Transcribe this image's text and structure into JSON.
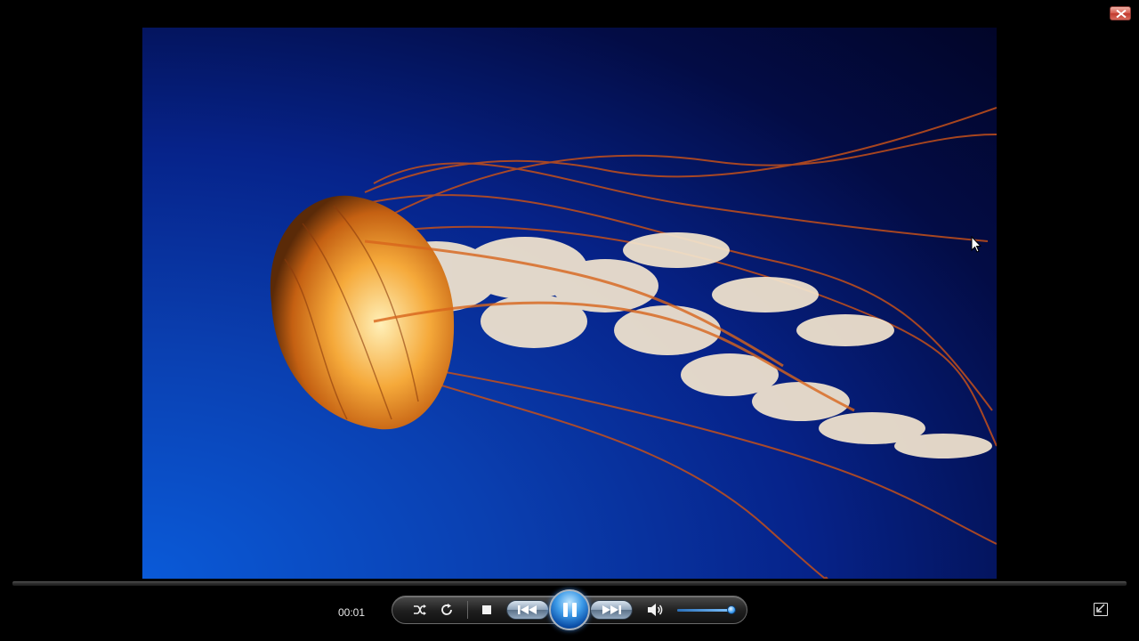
{
  "playback": {
    "elapsed": "00:01",
    "seek_position": 0.0,
    "state": "playing"
  },
  "volume": {
    "level": 0.92
  },
  "icons": {
    "close": "close-icon",
    "shuffle": "shuffle-icon",
    "repeat": "repeat-icon",
    "stop": "stop-icon",
    "previous": "previous-track-icon",
    "pause": "pause-icon",
    "next": "next-track-icon",
    "volume": "speaker-icon",
    "fullscreen": "exit-fullscreen-icon",
    "cursor": "mouse-pointer-icon"
  },
  "colors": {
    "background": "#000000",
    "accent": "#3d9be8",
    "close_button": "#d5574a",
    "video_deep_blue": "#020528",
    "jellyfish_orange": "#e07a1a"
  }
}
